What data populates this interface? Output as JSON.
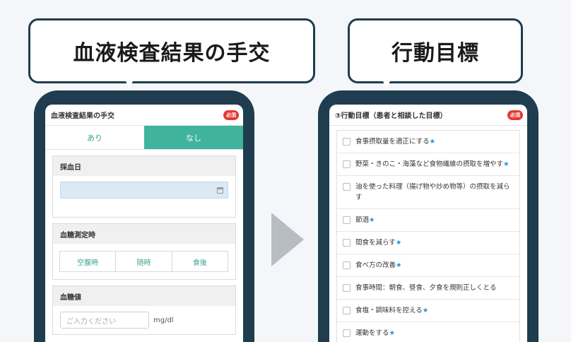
{
  "left_bubble": {
    "text": "血液検査結果の手交"
  },
  "right_bubble": {
    "text": "行動目標"
  },
  "left_screen": {
    "title": "血液検査結果の手交",
    "badge": "必須",
    "toggle": {
      "yes": "あり",
      "no": "なし",
      "selected": "なし"
    },
    "date_section": {
      "title": "採血日",
      "value": ""
    },
    "timing_section": {
      "title": "血糖測定時",
      "options": [
        "空腹時",
        "随時",
        "食後"
      ]
    },
    "value_section": {
      "title": "血糖値",
      "placeholder": "ご入力ください",
      "unit": "mg/dl"
    }
  },
  "right_screen": {
    "title": "③行動目標（患者と相談した目標）",
    "badge": "必須",
    "items": [
      {
        "label": "食事摂取量を適正にする",
        "star": "★"
      },
      {
        "label": "野菜・きのこ・海藻など食物繊維の摂取を増やす",
        "star": "★"
      },
      {
        "label": "油を使った料理（揚げ物や炒め物等）の摂取を減らす",
        "star": ""
      },
      {
        "label": "節酒",
        "star": "★"
      },
      {
        "label": "間食を減らす",
        "star": "★"
      },
      {
        "label": "食べ方の改善",
        "star": "★"
      },
      {
        "label": "食事時間：朝食、昼食、夕食を規則正しくとる",
        "star": ""
      },
      {
        "label": "食塩・調味料を控える",
        "star": "★"
      },
      {
        "label": "運動をする",
        "star": "★"
      }
    ]
  },
  "colors": {
    "accent": "#3fb39b",
    "frame": "#1f3d4f",
    "badge": "#e53935",
    "star": "#1e9bd7"
  }
}
